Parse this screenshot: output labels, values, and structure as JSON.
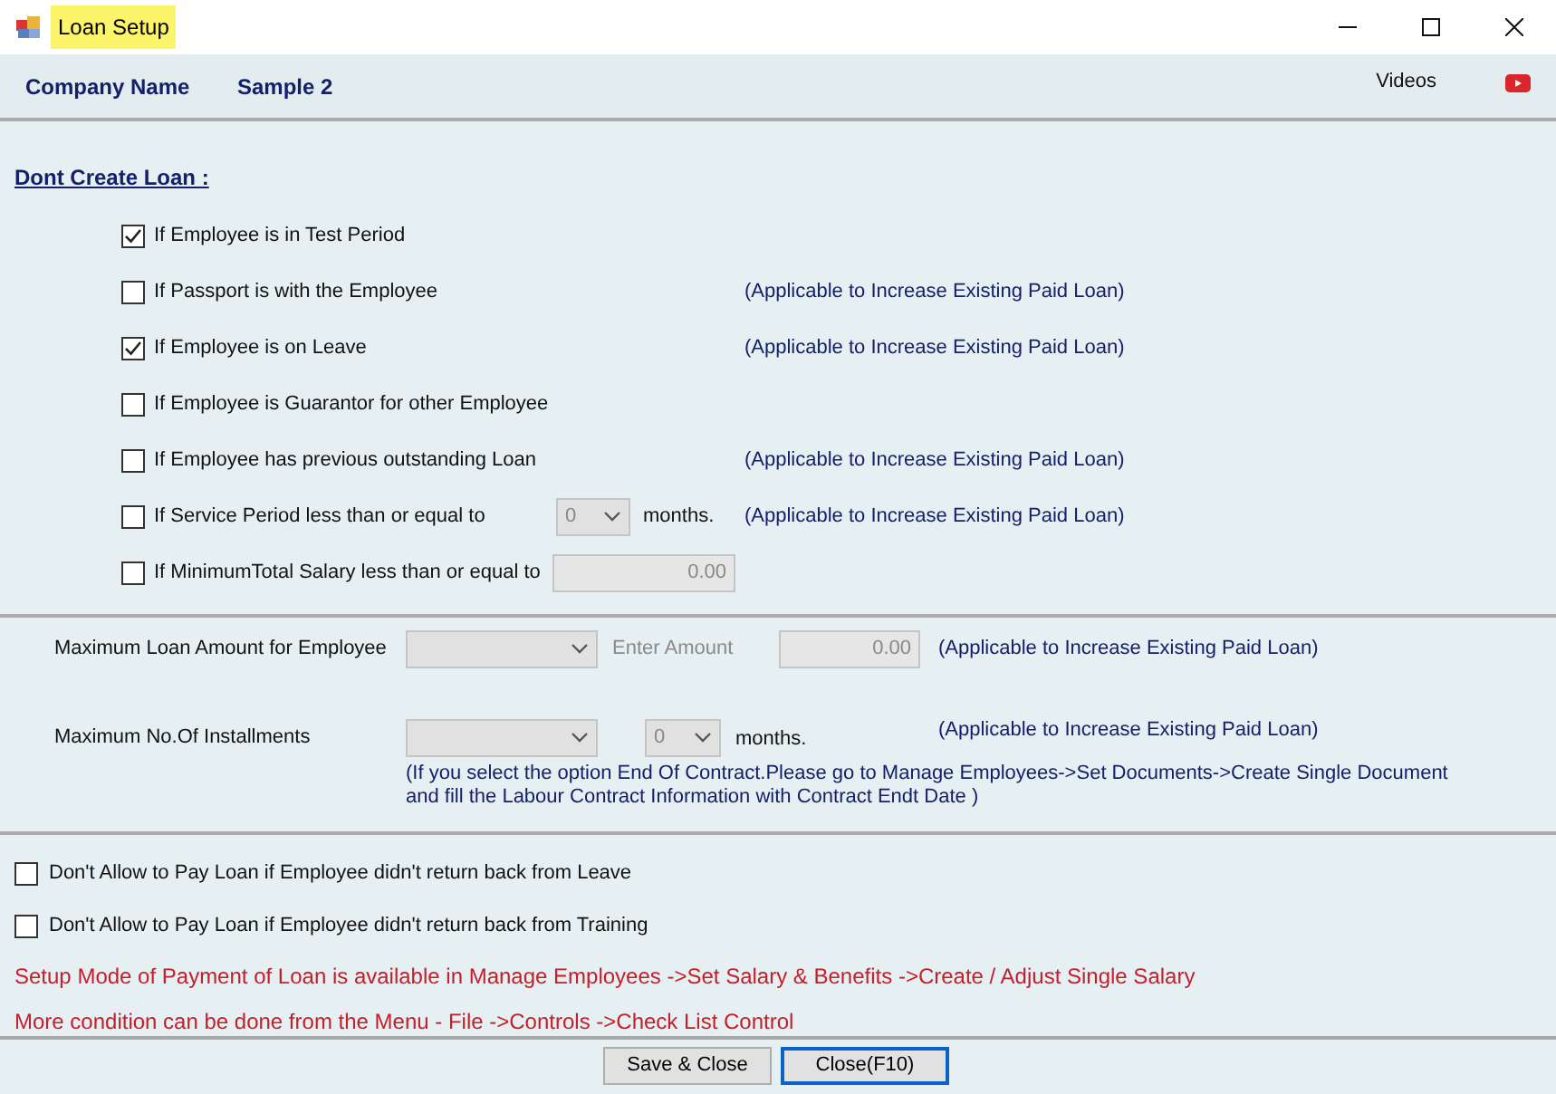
{
  "window": {
    "title": "Loan Setup"
  },
  "header": {
    "company_label": "Company Name",
    "company_value": "Sample 2",
    "videos_link": "Videos"
  },
  "dont_create_loan": {
    "heading": "Dont Create Loan :",
    "conditions": [
      {
        "kind": "plain",
        "label": "If Employee is in Test Period",
        "checked": true
      },
      {
        "kind": "plain",
        "label": "If Passport is with the Employee",
        "checked": false,
        "note": "(Applicable to Increase Existing Paid Loan)"
      },
      {
        "kind": "plain",
        "label": "If Employee is on Leave",
        "checked": true,
        "note": "(Applicable to Increase Existing Paid Loan)"
      },
      {
        "kind": "plain",
        "label": "If Employee is Guarantor for other Employee",
        "checked": false
      },
      {
        "kind": "plain",
        "label": "If Employee has previous outstanding Loan",
        "checked": false,
        "note": "(Applicable to Increase Existing Paid Loan)"
      },
      {
        "kind": "months",
        "label": "If Service Period less than or equal to",
        "checked": false,
        "value": "0",
        "unit": "months.",
        "note": "(Applicable to Increase Existing Paid Loan)"
      },
      {
        "kind": "amount",
        "label": "If MinimumTotal Salary less than or equal to",
        "checked": false,
        "value": "0.00"
      }
    ]
  },
  "limits": {
    "max_amount": {
      "label": "Maximum Loan Amount for Employee",
      "amount_label": "Enter Amount",
      "amount_value": "0.00",
      "note": "(Applicable to Increase Existing Paid Loan)"
    },
    "max_installments": {
      "label": "Maximum No.Of Installments",
      "months_value": "0",
      "unit": "months.",
      "note": "(Applicable to Increase Existing Paid Loan)"
    },
    "contract_note": [
      "(If you select the option End Of Contract.Please go to Manage Employees->Set Documents->Create Single Document",
      "and fill the Labour Contract Information with Contract Endt Date )"
    ]
  },
  "pay_restrictions": [
    {
      "label": "Don't Allow to Pay Loan if Employee didn't return back from Leave",
      "checked": false
    },
    {
      "label": "Don't Allow to Pay Loan if Employee didn't return back from Training",
      "checked": false
    }
  ],
  "info_lines": [
    "Setup Mode of Payment of Loan is available in Manage Employees ->Set Salary & Benefits ->Create / Adjust Single Salary",
    "More condition can be done from the Menu - File ->Controls ->Check List Control"
  ],
  "buttons": [
    {
      "label": "Save & Close",
      "selected": false
    },
    {
      "label": "Close(F10)",
      "selected": true
    }
  ]
}
